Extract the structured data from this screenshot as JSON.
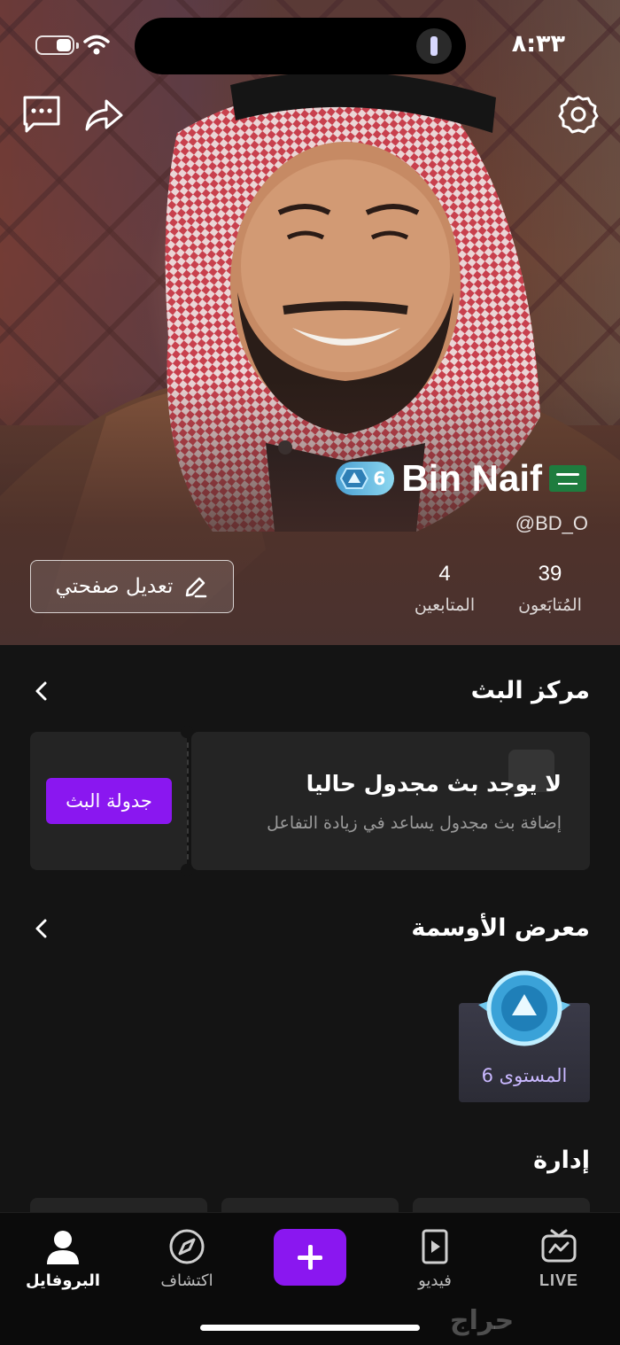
{
  "status_bar": {
    "time": "٨:٣٣"
  },
  "profile": {
    "display_name": "Bin Naif",
    "username": "@BD_O",
    "level": "6",
    "following_count": "39",
    "following_label": "المُتابَعون",
    "followers_count": "4",
    "followers_label": "المتابعين",
    "edit_button": "تعديل صفحتي"
  },
  "live_center": {
    "title": "مركز البث",
    "empty_title": "لا يوجد بث مجدول حاليا",
    "empty_subtitle": "إضافة بث مجدول يساعد في زيادة التفاعل",
    "schedule_button": "جدولة البث"
  },
  "badges": {
    "title": "معرض الأوسمة",
    "items": [
      {
        "label": "المستوى 6"
      }
    ]
  },
  "management": {
    "title": "إدارة"
  },
  "tab_bar": {
    "items": [
      {
        "label": "البروفايل",
        "icon": "person-icon",
        "active": true
      },
      {
        "label": "اكتشاف",
        "icon": "compass-icon",
        "active": false
      },
      {
        "label": "",
        "icon": "plus-icon",
        "active": false
      },
      {
        "label": "فيديو",
        "icon": "video-icon",
        "active": false
      },
      {
        "label": "LIVE",
        "icon": "tv-icon",
        "active": false
      }
    ]
  },
  "watermark": "حراج",
  "colors": {
    "accent": "#8a17f0",
    "background": "#141414",
    "card": "#242424"
  }
}
